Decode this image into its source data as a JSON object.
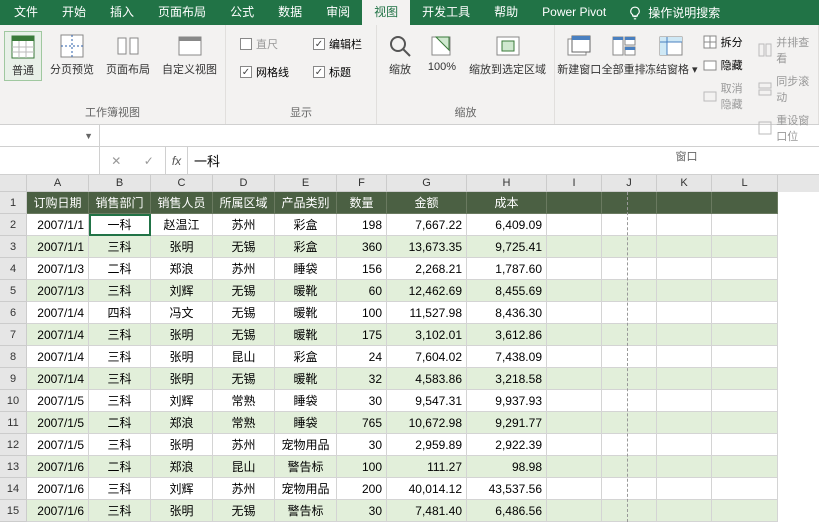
{
  "ribbon": {
    "tabs": [
      "文件",
      "开始",
      "插入",
      "页面布局",
      "公式",
      "数据",
      "审阅",
      "视图",
      "开发工具",
      "帮助",
      "Power Pivot"
    ],
    "active_tab": "视图",
    "tell_me": "操作说明搜索",
    "groups": {
      "views": {
        "label": "工作簿视图",
        "normal": "普通",
        "page_break": "分页预览",
        "page_layout": "页面布局",
        "custom": "自定义视图"
      },
      "show": {
        "label": "显示",
        "ruler": "直尺",
        "formula_bar": "编辑栏",
        "gridlines": "网格线",
        "headings": "标题"
      },
      "zoom": {
        "label": "缩放",
        "zoom": "缩放",
        "hundred": "100%",
        "selection": "缩放到选定区域"
      },
      "window": {
        "label": "窗口",
        "new": "新建窗口",
        "arrange": "全部重排",
        "freeze": "冻结窗格",
        "split": "拆分",
        "hide": "隐藏",
        "unhide": "取消隐藏",
        "side": "并排查看",
        "sync": "同步滚动",
        "reset": "重设窗口位"
      }
    }
  },
  "namebox": "",
  "formula_value": "一科",
  "columns": [
    "A",
    "B",
    "C",
    "D",
    "E",
    "F",
    "G",
    "H",
    "I",
    "J",
    "K",
    "L"
  ],
  "col_widths": [
    "cA",
    "cB",
    "cC",
    "cD",
    "cE",
    "cF",
    "cG",
    "cH",
    "cI",
    "cJ",
    "cK",
    "cL"
  ],
  "header_row": [
    "订购日期",
    "销售部门",
    "销售人员",
    "所属区域",
    "产品类别",
    "数量",
    "金额",
    "成本"
  ],
  "data_rows": [
    [
      "2007/1/1",
      "一科",
      "赵温江",
      "苏州",
      "彩盒",
      "198",
      "7,667.22",
      "6,409.09"
    ],
    [
      "2007/1/1",
      "三科",
      "张明",
      "无锡",
      "彩盒",
      "360",
      "13,673.35",
      "9,725.41"
    ],
    [
      "2007/1/3",
      "二科",
      "郑浪",
      "苏州",
      "睡袋",
      "156",
      "2,268.21",
      "1,787.60"
    ],
    [
      "2007/1/3",
      "三科",
      "刘辉",
      "无锡",
      "暖靴",
      "60",
      "12,462.69",
      "8,455.69"
    ],
    [
      "2007/1/4",
      "四科",
      "冯文",
      "无锡",
      "暖靴",
      "100",
      "11,527.98",
      "8,436.30"
    ],
    [
      "2007/1/4",
      "三科",
      "张明",
      "无锡",
      "暖靴",
      "175",
      "3,102.01",
      "3,612.86"
    ],
    [
      "2007/1/4",
      "三科",
      "张明",
      "昆山",
      "彩盒",
      "24",
      "7,604.02",
      "7,438.09"
    ],
    [
      "2007/1/4",
      "三科",
      "张明",
      "无锡",
      "暖靴",
      "32",
      "4,583.86",
      "3,218.58"
    ],
    [
      "2007/1/5",
      "三科",
      "刘辉",
      "常熟",
      "睡袋",
      "30",
      "9,547.31",
      "9,937.93"
    ],
    [
      "2007/1/5",
      "二科",
      "郑浪",
      "常熟",
      "睡袋",
      "765",
      "10,672.98",
      "9,291.77"
    ],
    [
      "2007/1/5",
      "三科",
      "张明",
      "苏州",
      "宠物用品",
      "30",
      "2,959.89",
      "2,922.39"
    ],
    [
      "2007/1/6",
      "二科",
      "郑浪",
      "昆山",
      "警告标",
      "100",
      "111.27",
      "98.98"
    ],
    [
      "2007/1/6",
      "三科",
      "刘辉",
      "苏州",
      "宠物用品",
      "200",
      "40,014.12",
      "43,537.56"
    ],
    [
      "2007/1/6",
      "三科",
      "张明",
      "无锡",
      "警告标",
      "30",
      "7,481.40",
      "6,486.56"
    ]
  ]
}
